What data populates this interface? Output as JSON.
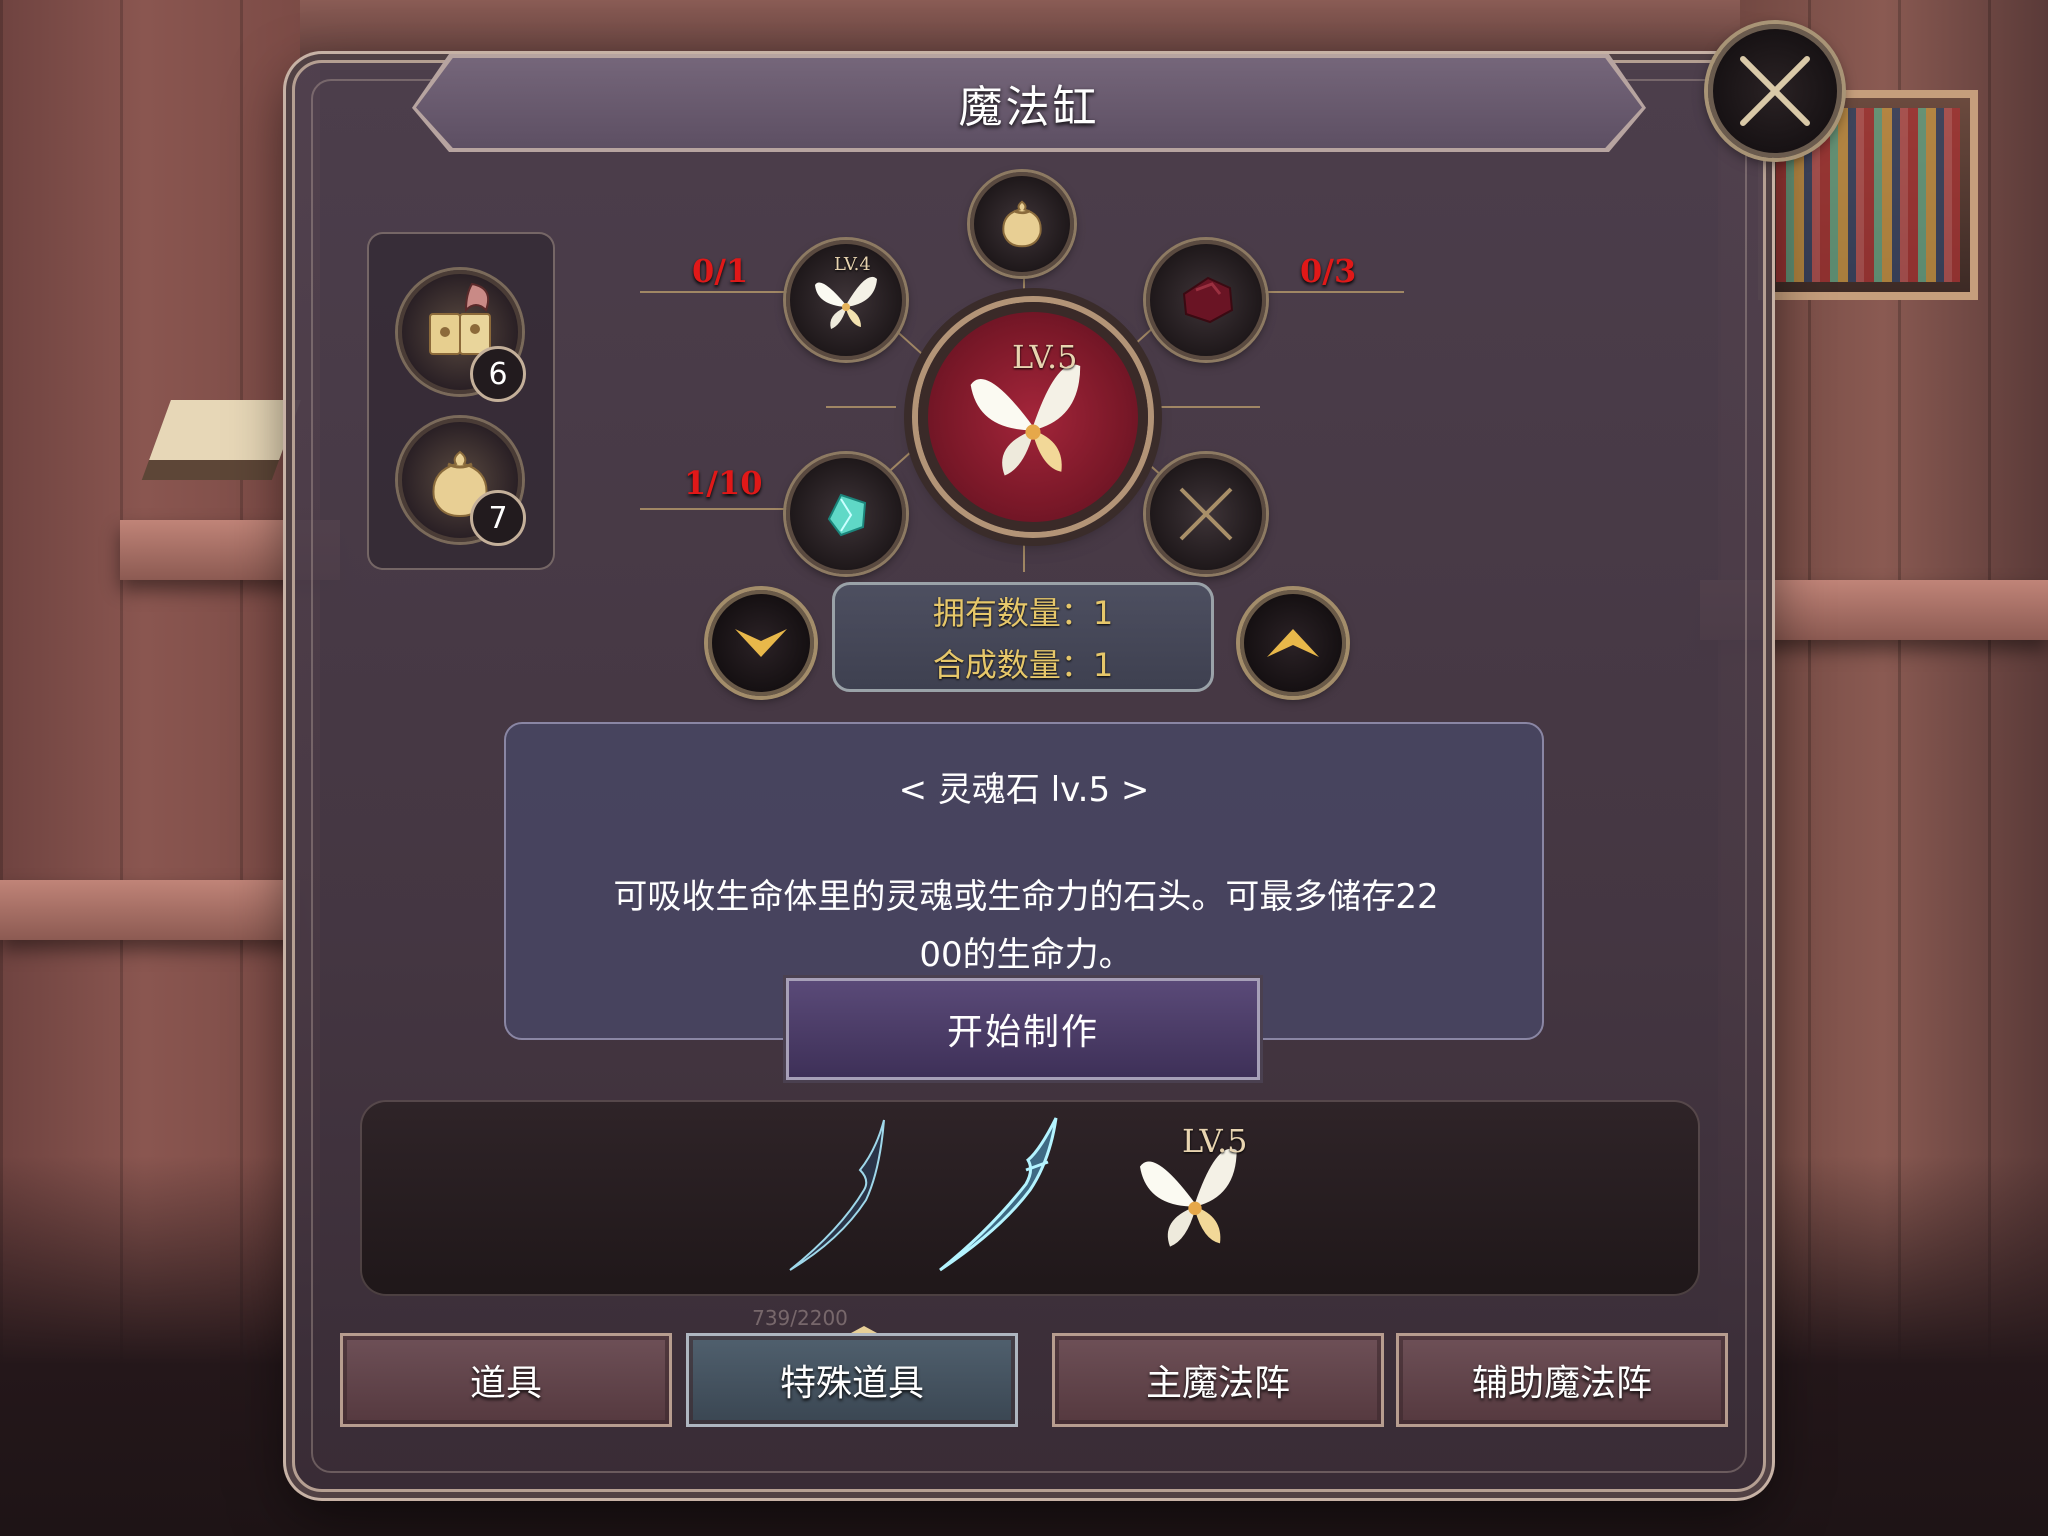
{
  "window": {
    "title": "魔法缸"
  },
  "inventory": [
    {
      "icon": "spellbook-icon",
      "count": "6"
    },
    {
      "icon": "pouch-icon",
      "count": "7"
    }
  ],
  "recipe": {
    "target": {
      "icon": "butterfly-soulstone-icon",
      "level": "LV.5"
    },
    "materials": [
      {
        "slot": "top-left",
        "icon": "butterfly-soulstone-icon",
        "level": "LV.4",
        "requirement": "0/1"
      },
      {
        "slot": "top",
        "icon": "pouch-icon"
      },
      {
        "slot": "top-right",
        "icon": "red-ore-icon",
        "requirement": "0/3"
      },
      {
        "slot": "bottom-left",
        "icon": "cyan-crystal-icon",
        "requirement": "1/10"
      },
      {
        "slot": "bottom-right",
        "icon": "empty-slot-icon"
      }
    ],
    "requirement_color": "#e01818"
  },
  "quantity": {
    "owned_label": "拥有数量：1",
    "craft_label": "合成数量：1"
  },
  "description": {
    "name": "< 灵魂石 lv.5 >",
    "text_line1": "可吸收生命体里的灵魂或生命力的石头。可最多储存22",
    "text_line2": "00的生命力。"
  },
  "actions": {
    "start_label": "开始制作"
  },
  "preview": {
    "items": [
      {
        "icon": "dark-feather-icon"
      },
      {
        "icon": "cyan-feather-icon"
      },
      {
        "icon": "butterfly-soulstone-icon",
        "level": "LV.5"
      }
    ],
    "caption": "739/2200"
  },
  "tabs": [
    {
      "label": "道具",
      "active": false
    },
    {
      "label": "特殊道具",
      "active": true
    },
    {
      "label": "主魔法阵",
      "active": false
    },
    {
      "label": "辅助魔法阵",
      "active": false
    }
  ],
  "colors": {
    "accent_gold": "#e6c76a",
    "panel": "#4e404e",
    "active_tab": "#50606e"
  }
}
